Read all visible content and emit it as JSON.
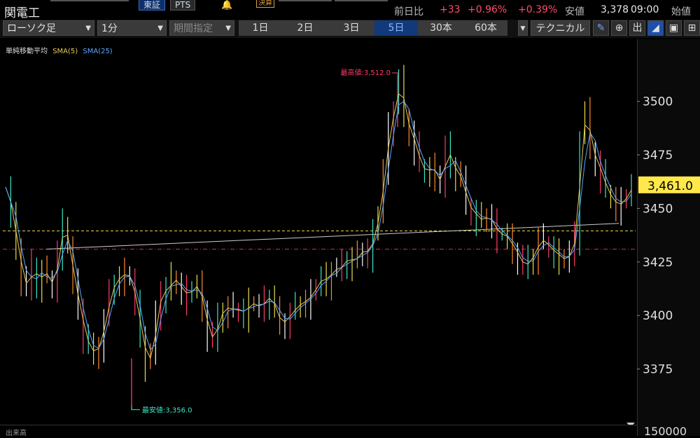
{
  "header": {
    "symbol": "関電工",
    "market_tabs": [
      "東証",
      "PTS"
    ],
    "kessan_label": "決算",
    "change_label": "前日比",
    "change_value": "+33",
    "change_pct": "+0.96%",
    "change_pct2": "+0.39%",
    "low_label": "安値",
    "low_value": "3,378",
    "low_time": "09:00",
    "open_label": "始値",
    "colors": {
      "up": "#ff4d6a",
      "active_tab": "#123a7a"
    }
  },
  "toolbar": {
    "chart_type": "ローソク足",
    "interval": "1分",
    "period": "期間指定",
    "ranges": [
      "1日",
      "2日",
      "3日",
      "5日",
      "30本",
      "60本"
    ],
    "active_range": "5日",
    "technical": "テクニカル",
    "icons": [
      "draw-pen-icon",
      "zoom-icon",
      "volume-toggle-icon",
      "area-chart-icon",
      "save-icon",
      "settings-icon"
    ],
    "icon_labels": {
      "volume": "出"
    }
  },
  "chart_data": {
    "type": "line",
    "indicator_label": "単純移動平均",
    "series": [
      {
        "name": "SMA(5)",
        "color": "#e8c85a"
      },
      {
        "name": "SMA(25)",
        "color": "#5aa8ff"
      }
    ],
    "price_series": [
      3460,
      3446,
      3433,
      3418,
      3412,
      3424,
      3415,
      3421,
      3418,
      3413,
      3430,
      3443,
      3432,
      3415,
      3405,
      3391,
      3385,
      3382,
      3387,
      3398,
      3410,
      3416,
      3418,
      3420,
      3417,
      3405,
      3392,
      3378,
      3382,
      3400,
      3413,
      3410,
      3418,
      3415,
      3412,
      3409,
      3413,
      3414,
      3404,
      3392,
      3388,
      3399,
      3403,
      3404,
      3402,
      3403,
      3401,
      3406,
      3405,
      3404,
      3407,
      3409,
      3402,
      3396,
      3398,
      3401,
      3404,
      3406,
      3407,
      3410,
      3414,
      3418,
      3416,
      3422,
      3421,
      3424,
      3427,
      3425,
      3428,
      3431,
      3429,
      3438,
      3448,
      3468,
      3488,
      3497,
      3510,
      3493,
      3486,
      3479,
      3470,
      3467,
      3469,
      3467,
      3460,
      3479,
      3471,
      3467,
      3463,
      3452,
      3449,
      3446,
      3444,
      3447,
      3443,
      3438,
      3438,
      3436,
      3431,
      3428,
      3422,
      3426,
      3428,
      3436,
      3434,
      3432,
      3429,
      3428,
      3425,
      3430,
      3437,
      3483,
      3495,
      3478,
      3472,
      3466,
      3458,
      3455,
      3451,
      3453,
      3456,
      3461
    ],
    "y_ticks": [
      3500,
      3475,
      3450,
      3425,
      3400,
      3375
    ],
    "ylim": [
      3349,
      3529
    ],
    "current_price": 3461.0,
    "current_price_label": "3,461.0",
    "high_annotation": "最高値:3,512.0",
    "low_annotation": "最安値:3,356.0",
    "high_value": 3512.0,
    "low_value": 3356.0,
    "ref_lines": [
      {
        "name": "yellow-dashed",
        "value": 3439.5,
        "color": "#e8d44a"
      },
      {
        "name": "red-dashdot",
        "value": 3431,
        "color": "#c8304a"
      }
    ],
    "trend_line": {
      "start": 3431,
      "end": 3443,
      "color": "#cccccc"
    },
    "grid": false
  },
  "footer": {
    "volume_label": "出来高",
    "volume_max": "150000"
  }
}
